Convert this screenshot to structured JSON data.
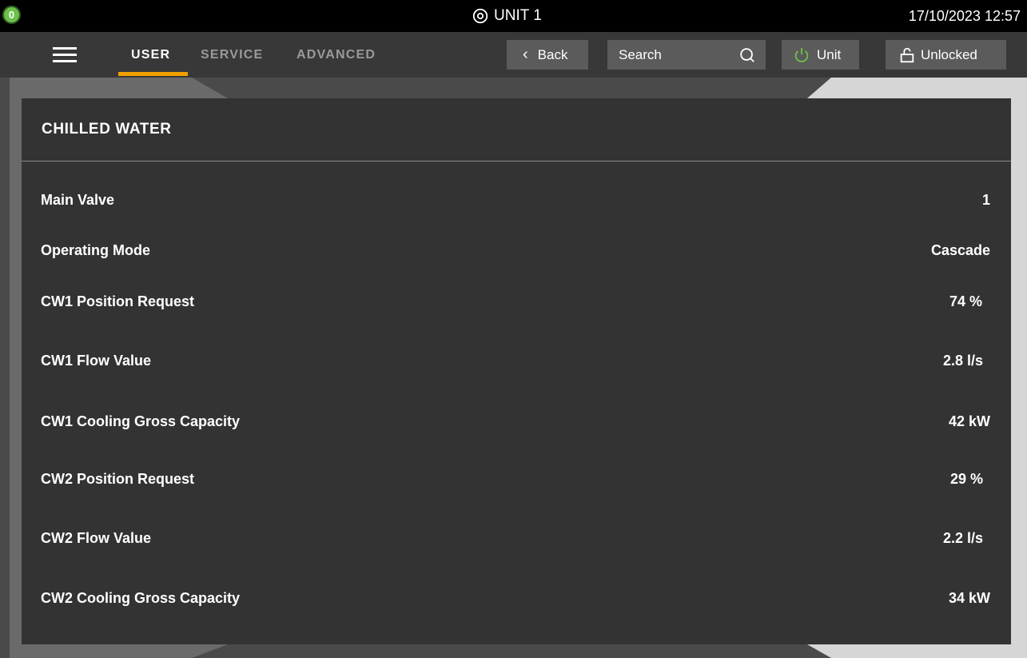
{
  "status_bar": {
    "alarm_count": "0",
    "unit_name": "UNIT 1",
    "datetime": "17/10/2023 12:57"
  },
  "nav": {
    "tabs": [
      {
        "label": "USER",
        "active": true
      },
      {
        "label": "SERVICE",
        "active": false
      },
      {
        "label": "ADVANCED",
        "active": false
      }
    ],
    "back_label": "Back",
    "search_label": "Search",
    "unit_label": "Unit",
    "lock_label": "Unlocked"
  },
  "panel": {
    "title": "CHILLED WATER",
    "rows": [
      {
        "label": "Main Valve",
        "value": "1"
      },
      {
        "label": "Operating Mode",
        "value": "Cascade"
      },
      {
        "label": "CW1 Position Request",
        "value": "74 %"
      },
      {
        "label": "CW1 Flow Value",
        "value": "2.8 l/s"
      },
      {
        "label": "CW1 Cooling Gross Capacity",
        "value": "42 kW"
      },
      {
        "label": "CW2 Position Request",
        "value": "29 %"
      },
      {
        "label": "CW2 Flow Value",
        "value": "2.2 l/s"
      },
      {
        "label": "CW2 Cooling Gross Capacity",
        "value": "34 kW"
      }
    ]
  },
  "colors": {
    "accent": "#f0a000",
    "alarm_ok": "#6cc04a",
    "power_icon": "#6cc04a",
    "panel_bg": "#333333",
    "nav_bg": "#383838"
  },
  "icons": {
    "alarm": "alarm-count-badge",
    "unit": "location-pin-icon",
    "menu": "hamburger-menu-icon",
    "back": "chevron-left-icon",
    "search": "search-icon",
    "power": "power-icon",
    "lock": "unlocked-padlock-icon"
  }
}
